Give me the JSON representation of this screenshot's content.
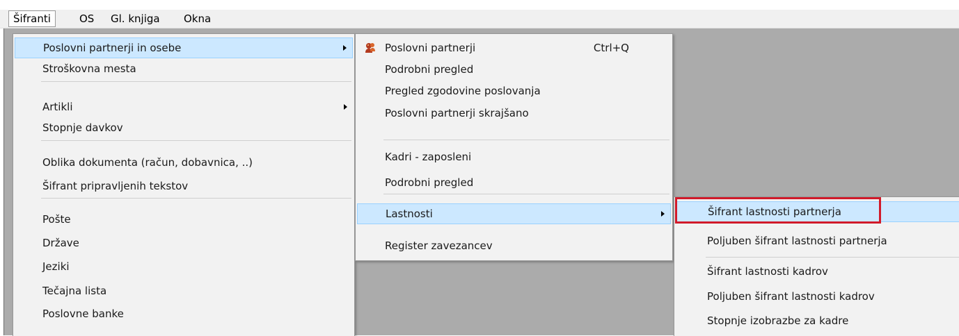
{
  "menubar": {
    "items": [
      {
        "label": "Šifranti",
        "active": true
      },
      {
        "label": "OS",
        "active": false
      },
      {
        "label": "Gl. knjiga",
        "active": false
      },
      {
        "label": "Okna",
        "active": false
      }
    ]
  },
  "menu1": {
    "items": [
      {
        "label": "Poslovni partnerji in osebe",
        "submenu": true,
        "highlighted": true
      },
      {
        "label": "Stroškovna mesta"
      },
      {
        "label": "Artikli",
        "submenu": true
      },
      {
        "label": "Stopnje davkov"
      },
      {
        "label": "Oblika dokumenta (račun, dobavnica, ..)"
      },
      {
        "label": "Šifrant pripravljenih tekstov"
      },
      {
        "label": "Pošte"
      },
      {
        "label": "Države"
      },
      {
        "label": "Jeziki"
      },
      {
        "label": "Tečajna lista"
      },
      {
        "label": "Poslovne banke"
      }
    ]
  },
  "menu2": {
    "items": [
      {
        "label": "Poslovni partnerji",
        "shortcut": "Ctrl+Q",
        "icon": "partner-icon"
      },
      {
        "label": "Podrobni pregled"
      },
      {
        "label": "Pregled zgodovine poslovanja"
      },
      {
        "label": "Poslovni partnerji skrajšano"
      },
      {
        "label": "Kadri - zaposleni"
      },
      {
        "label": "Podrobni pregled"
      },
      {
        "label": "Lastnosti",
        "submenu": true,
        "highlighted": true
      },
      {
        "label": "Register zavezancev"
      }
    ]
  },
  "menu3": {
    "items": [
      {
        "label": "Šifrant lastnosti partnerja",
        "highlighted": true,
        "annotated": true
      },
      {
        "label": "Poljuben šifrant lastnosti partnerja"
      },
      {
        "label": "Šifrant lastnosti kadrov"
      },
      {
        "label": "Poljuben šifrant lastnosti kadrov"
      },
      {
        "label": "Stopnje izobrazbe za kadre"
      }
    ]
  },
  "colors": {
    "highlight": "#cce8ff",
    "highlight_border": "#99d1ff",
    "annotation": "#d11a2a",
    "workspace": "#ababab"
  }
}
